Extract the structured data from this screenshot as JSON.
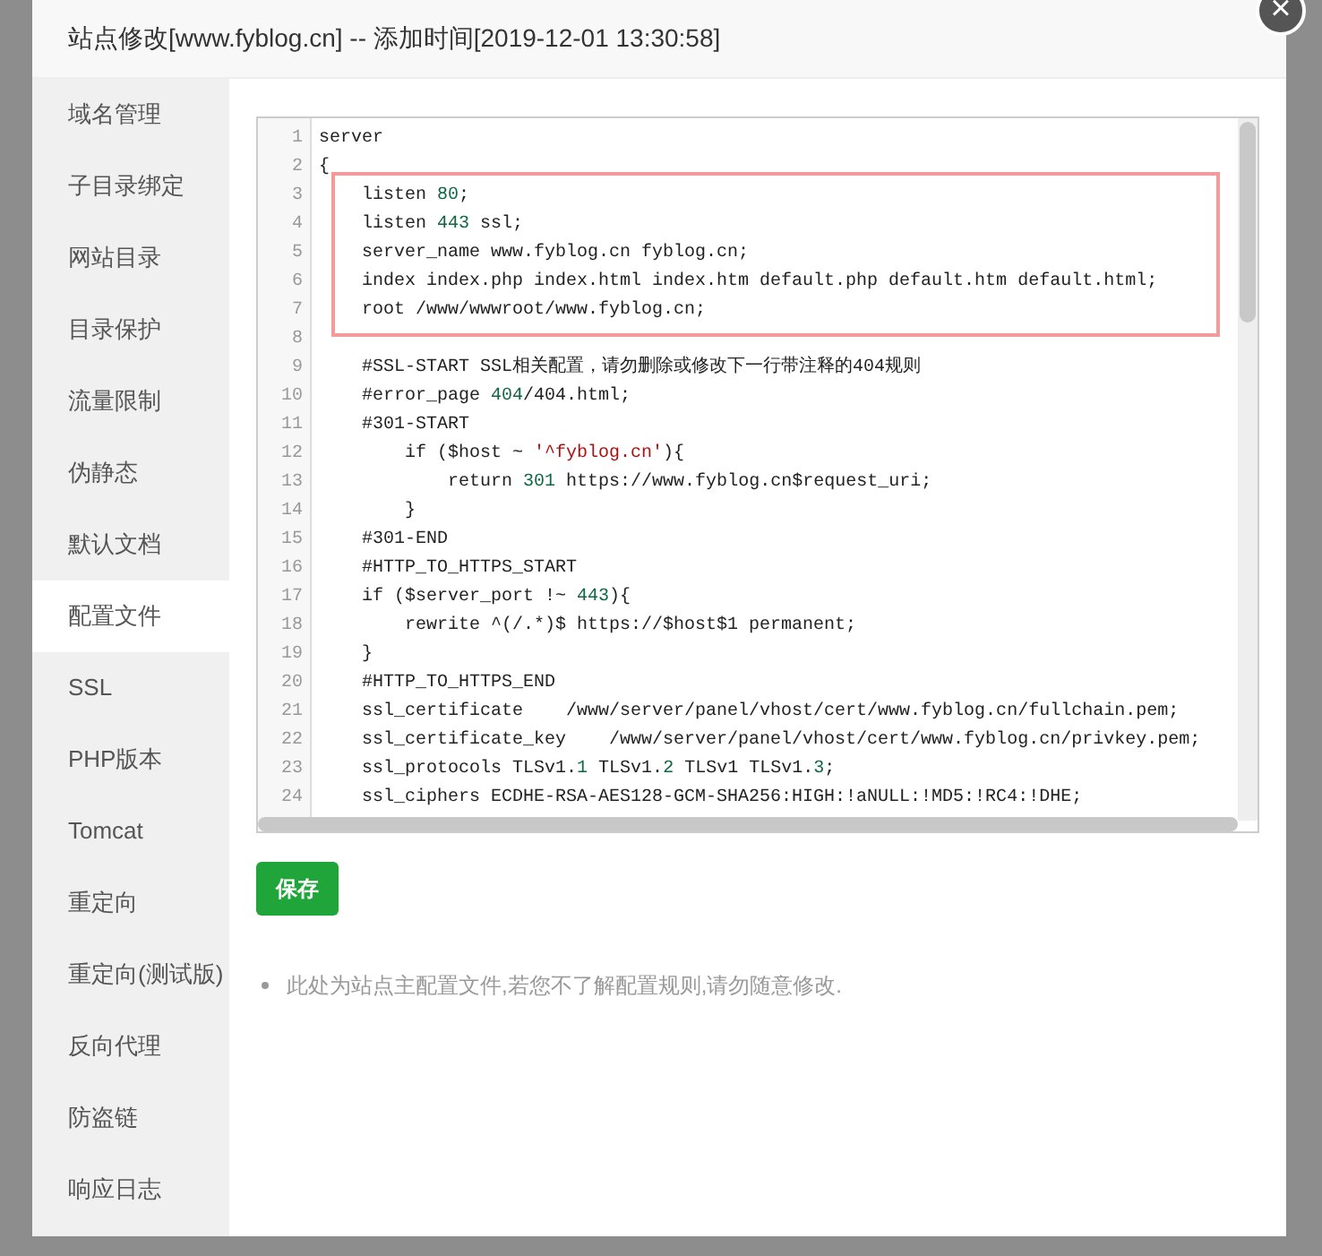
{
  "dialog": {
    "title": "站点修改[www.fyblog.cn] -- 添加时间[2019-12-01 13:30:58]",
    "close": "×"
  },
  "sidebar": {
    "items": [
      {
        "label": "域名管理",
        "selected": false
      },
      {
        "label": "子目录绑定",
        "selected": false
      },
      {
        "label": "网站目录",
        "selected": false
      },
      {
        "label": "目录保护",
        "selected": false
      },
      {
        "label": "流量限制",
        "selected": false
      },
      {
        "label": "伪静态",
        "selected": false
      },
      {
        "label": "默认文档",
        "selected": false
      },
      {
        "label": "配置文件",
        "selected": true
      },
      {
        "label": "SSL",
        "selected": false
      },
      {
        "label": "PHP版本",
        "selected": false
      },
      {
        "label": "Tomcat",
        "selected": false
      },
      {
        "label": "重定向",
        "selected": false
      },
      {
        "label": "重定向(测试版)",
        "selected": false
      },
      {
        "label": "反向代理",
        "selected": false
      },
      {
        "label": "防盗链",
        "selected": false
      },
      {
        "label": "响应日志",
        "selected": false
      }
    ]
  },
  "editor": {
    "lines": [
      {
        "number": "1",
        "highlighted": false,
        "tokens": [
          {
            "kind": "text",
            "text": "server"
          }
        ]
      },
      {
        "number": "2",
        "highlighted": false,
        "tokens": [
          {
            "kind": "text",
            "text": "{"
          }
        ]
      },
      {
        "number": "3",
        "highlighted": true,
        "tokens": [
          {
            "kind": "text",
            "text": "    listen "
          },
          {
            "kind": "number",
            "text": "80"
          },
          {
            "kind": "text",
            "text": ";"
          }
        ]
      },
      {
        "number": "4",
        "highlighted": true,
        "tokens": [
          {
            "kind": "text",
            "text": "    listen "
          },
          {
            "kind": "number",
            "text": "443"
          },
          {
            "kind": "text",
            "text": " ssl;"
          }
        ]
      },
      {
        "number": "5",
        "highlighted": true,
        "tokens": [
          {
            "kind": "text",
            "text": "    server_name www.fyblog.cn fyblog.cn;"
          }
        ]
      },
      {
        "number": "6",
        "highlighted": true,
        "tokens": [
          {
            "kind": "text",
            "text": "    index index.php index.html index.htm default.php default.htm default.html;"
          }
        ]
      },
      {
        "number": "7",
        "highlighted": true,
        "tokens": [
          {
            "kind": "text",
            "text": "    root /www/wwwroot/www.fyblog.cn;"
          }
        ]
      },
      {
        "number": "8",
        "highlighted": false
      },
      {
        "number": "9",
        "highlighted": false,
        "tokens": [
          {
            "kind": "text",
            "text": "    #SSL-START SSL相关配置，请勿删除或修改下一行带注释的404规则"
          }
        ]
      },
      {
        "number": "10",
        "highlighted": false,
        "tokens": [
          {
            "kind": "text",
            "text": "    #error_page "
          },
          {
            "kind": "number",
            "text": "404"
          },
          {
            "kind": "text",
            "text": "/404.html;"
          }
        ]
      },
      {
        "number": "11",
        "highlighted": false,
        "tokens": [
          {
            "kind": "text",
            "text": "    #301-START"
          }
        ]
      },
      {
        "number": "12",
        "highlighted": false,
        "tokens": [
          {
            "kind": "text",
            "text": "        if ($host ~ "
          },
          {
            "kind": "string",
            "text": "'^fyblog.cn'"
          },
          {
            "kind": "text",
            "text": "){"
          }
        ]
      },
      {
        "number": "13",
        "highlighted": false,
        "tokens": [
          {
            "kind": "text",
            "text": "            return "
          },
          {
            "kind": "number",
            "text": "301"
          },
          {
            "kind": "text",
            "text": " https://www.fyblog.cn$request_uri;"
          }
        ]
      },
      {
        "number": "14",
        "highlighted": false,
        "tokens": [
          {
            "kind": "text",
            "text": "        }"
          }
        ]
      },
      {
        "number": "15",
        "highlighted": false,
        "tokens": [
          {
            "kind": "text",
            "text": "    #301-END"
          }
        ]
      },
      {
        "number": "16",
        "highlighted": false,
        "tokens": [
          {
            "kind": "text",
            "text": "    #HTTP_TO_HTTPS_START"
          }
        ]
      },
      {
        "number": "17",
        "highlighted": false,
        "tokens": [
          {
            "kind": "text",
            "text": "    if ($server_port !~ "
          },
          {
            "kind": "number",
            "text": "443"
          },
          {
            "kind": "text",
            "text": "){"
          }
        ]
      },
      {
        "number": "18",
        "highlighted": false,
        "tokens": [
          {
            "kind": "text",
            "text": "        rewrite ^(/.*)$ https://$host$1 permanent;"
          }
        ]
      },
      {
        "number": "19",
        "highlighted": false,
        "tokens": [
          {
            "kind": "text",
            "text": "    }"
          }
        ]
      },
      {
        "number": "20",
        "highlighted": false,
        "tokens": [
          {
            "kind": "text",
            "text": "    #HTTP_TO_HTTPS_END"
          }
        ]
      },
      {
        "number": "21",
        "highlighted": false,
        "tokens": [
          {
            "kind": "text",
            "text": "    ssl_certificate    /www/server/panel/vhost/cert/www.fyblog.cn/fullchain.pem;"
          }
        ]
      },
      {
        "number": "22",
        "highlighted": false,
        "tokens": [
          {
            "kind": "text",
            "text": "    ssl_certificate_key    /www/server/panel/vhost/cert/www.fyblog.cn/privkey.pem;"
          }
        ]
      },
      {
        "number": "23",
        "highlighted": false,
        "tokens": [
          {
            "kind": "text",
            "text": "    ssl_protocols TLSv1."
          },
          {
            "kind": "number",
            "text": "1"
          },
          {
            "kind": "text",
            "text": " TLSv1."
          },
          {
            "kind": "number",
            "text": "2"
          },
          {
            "kind": "text",
            "text": " TLSv1 TLSv1."
          },
          {
            "kind": "number",
            "text": "3"
          },
          {
            "kind": "text",
            "text": ";"
          }
        ]
      },
      {
        "number": "24",
        "highlighted": false,
        "tokens": [
          {
            "kind": "text",
            "text": "    ssl_ciphers ECDHE-RSA-AES128-GCM-SHA256:HIGH:!aNULL:!MD5:!RC4:!DHE;"
          }
        ]
      }
    ]
  },
  "save_button": "保存",
  "note": "此处为站点主配置文件,若您不了解配置规则,请勿随意修改."
}
